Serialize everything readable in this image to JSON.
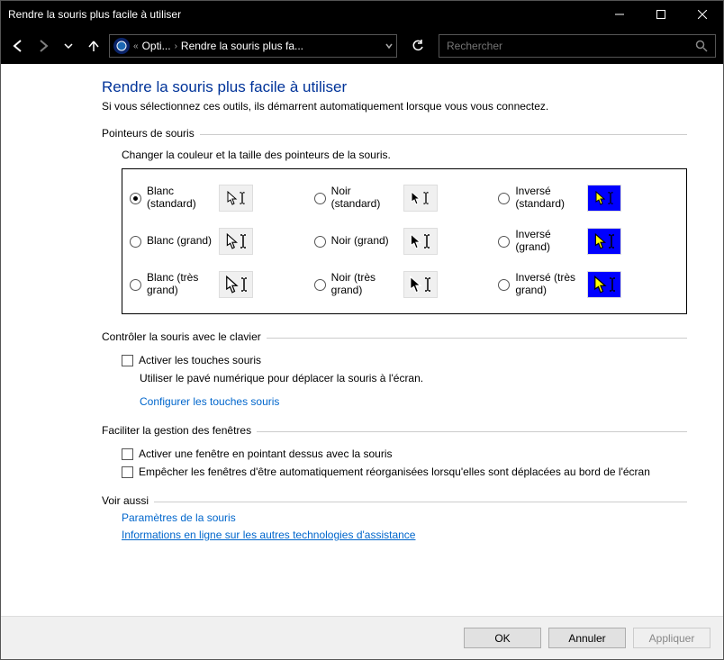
{
  "window": {
    "title": "Rendre la souris plus facile à utiliser"
  },
  "nav": {
    "bc_seg1": "Opti...",
    "bc_seg2": "Rendre la souris plus fa...",
    "search_placeholder": "Rechercher"
  },
  "page": {
    "heading": "Rendre la souris plus facile à utiliser",
    "sub": "Si vous sélectionnez ces outils, ils démarrent automatiquement lorsque vous vous connectez."
  },
  "pointers": {
    "legend": "Pointeurs de souris",
    "desc": "Changer la couleur et la taille des pointeurs de la souris.",
    "options": [
      {
        "id": "white-std",
        "label": "Blanc (standard)",
        "scheme": "white",
        "size": 1,
        "checked": true
      },
      {
        "id": "black-std",
        "label": "Noir (standard)",
        "scheme": "black",
        "size": 1,
        "checked": false
      },
      {
        "id": "inv-std",
        "label": "Inversé (standard)",
        "scheme": "inv",
        "size": 1,
        "checked": false
      },
      {
        "id": "white-lg",
        "label": "Blanc (grand)",
        "scheme": "white",
        "size": 2,
        "checked": false
      },
      {
        "id": "black-lg",
        "label": "Noir (grand)",
        "scheme": "black",
        "size": 2,
        "checked": false
      },
      {
        "id": "inv-lg",
        "label": "Inversé (grand)",
        "scheme": "inv",
        "size": 2,
        "checked": false
      },
      {
        "id": "white-xl",
        "label": "Blanc (très grand)",
        "scheme": "white",
        "size": 3,
        "checked": false
      },
      {
        "id": "black-xl",
        "label": "Noir (très grand)",
        "scheme": "black",
        "size": 3,
        "checked": false
      },
      {
        "id": "inv-xl",
        "label": "Inversé (très grand)",
        "scheme": "inv",
        "size": 3,
        "checked": false
      }
    ]
  },
  "keyboard": {
    "legend": "Contrôler la souris avec le clavier",
    "enable_label": "Activer les touches souris",
    "enable_desc": "Utiliser le pavé numérique pour déplacer la souris à l'écran.",
    "config_link": "Configurer les touches souris"
  },
  "windows_mgmt": {
    "legend": "Faciliter la gestion des fenêtres",
    "hover_activate": "Activer une fenêtre en pointant dessus avec la souris",
    "no_snap": "Empêcher les fenêtres d'être automatiquement réorganisées lorsqu'elles sont déplacées au bord de l'écran"
  },
  "seealso": {
    "legend": "Voir aussi",
    "mouse_settings": "Paramètres de la souris",
    "online_info": "Informations en ligne sur les autres technologies d'assistance"
  },
  "buttons": {
    "ok": "OK",
    "cancel": "Annuler",
    "apply": "Appliquer"
  }
}
